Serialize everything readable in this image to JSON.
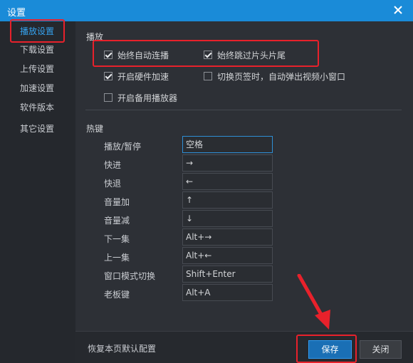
{
  "window": {
    "title": "设置",
    "close_icon": "close-icon"
  },
  "sidebar": {
    "items": [
      {
        "label": "播放设置",
        "active": true
      },
      {
        "label": "下载设置"
      },
      {
        "label": "上传设置"
      },
      {
        "label": "加速设置"
      },
      {
        "label": "软件版本"
      },
      {
        "label": "其它设置"
      }
    ]
  },
  "playback": {
    "section_title": "播放",
    "options": [
      {
        "label": "始终自动连播",
        "checked": true
      },
      {
        "label": "始终跳过片头片尾",
        "checked": true
      },
      {
        "label": "开启硬件加速",
        "checked": true
      },
      {
        "label": "切换页签时，自动弹出视频小窗口",
        "checked": false
      },
      {
        "label": "开启备用播放器",
        "checked": false
      }
    ]
  },
  "hotkeys": {
    "section_title": "热键",
    "rows": [
      {
        "label": "播放/暂停",
        "value": "空格"
      },
      {
        "label": "快进",
        "value": "→"
      },
      {
        "label": "快退",
        "value": "←"
      },
      {
        "label": "音量加",
        "value": "↑"
      },
      {
        "label": "音量减",
        "value": "↓"
      },
      {
        "label": "下一集",
        "value": "Alt+→"
      },
      {
        "label": "上一集",
        "value": "Alt+←"
      },
      {
        "label": "窗口模式切换",
        "value": "Shift+Enter"
      },
      {
        "label": "老板键",
        "value": "Alt+A"
      }
    ]
  },
  "footer": {
    "restore_label": "恢复本页默认配置",
    "save_label": "保存",
    "close_label": "关闭"
  },
  "colors": {
    "accent": "#1a8bd8",
    "highlight": "#e8212b"
  }
}
